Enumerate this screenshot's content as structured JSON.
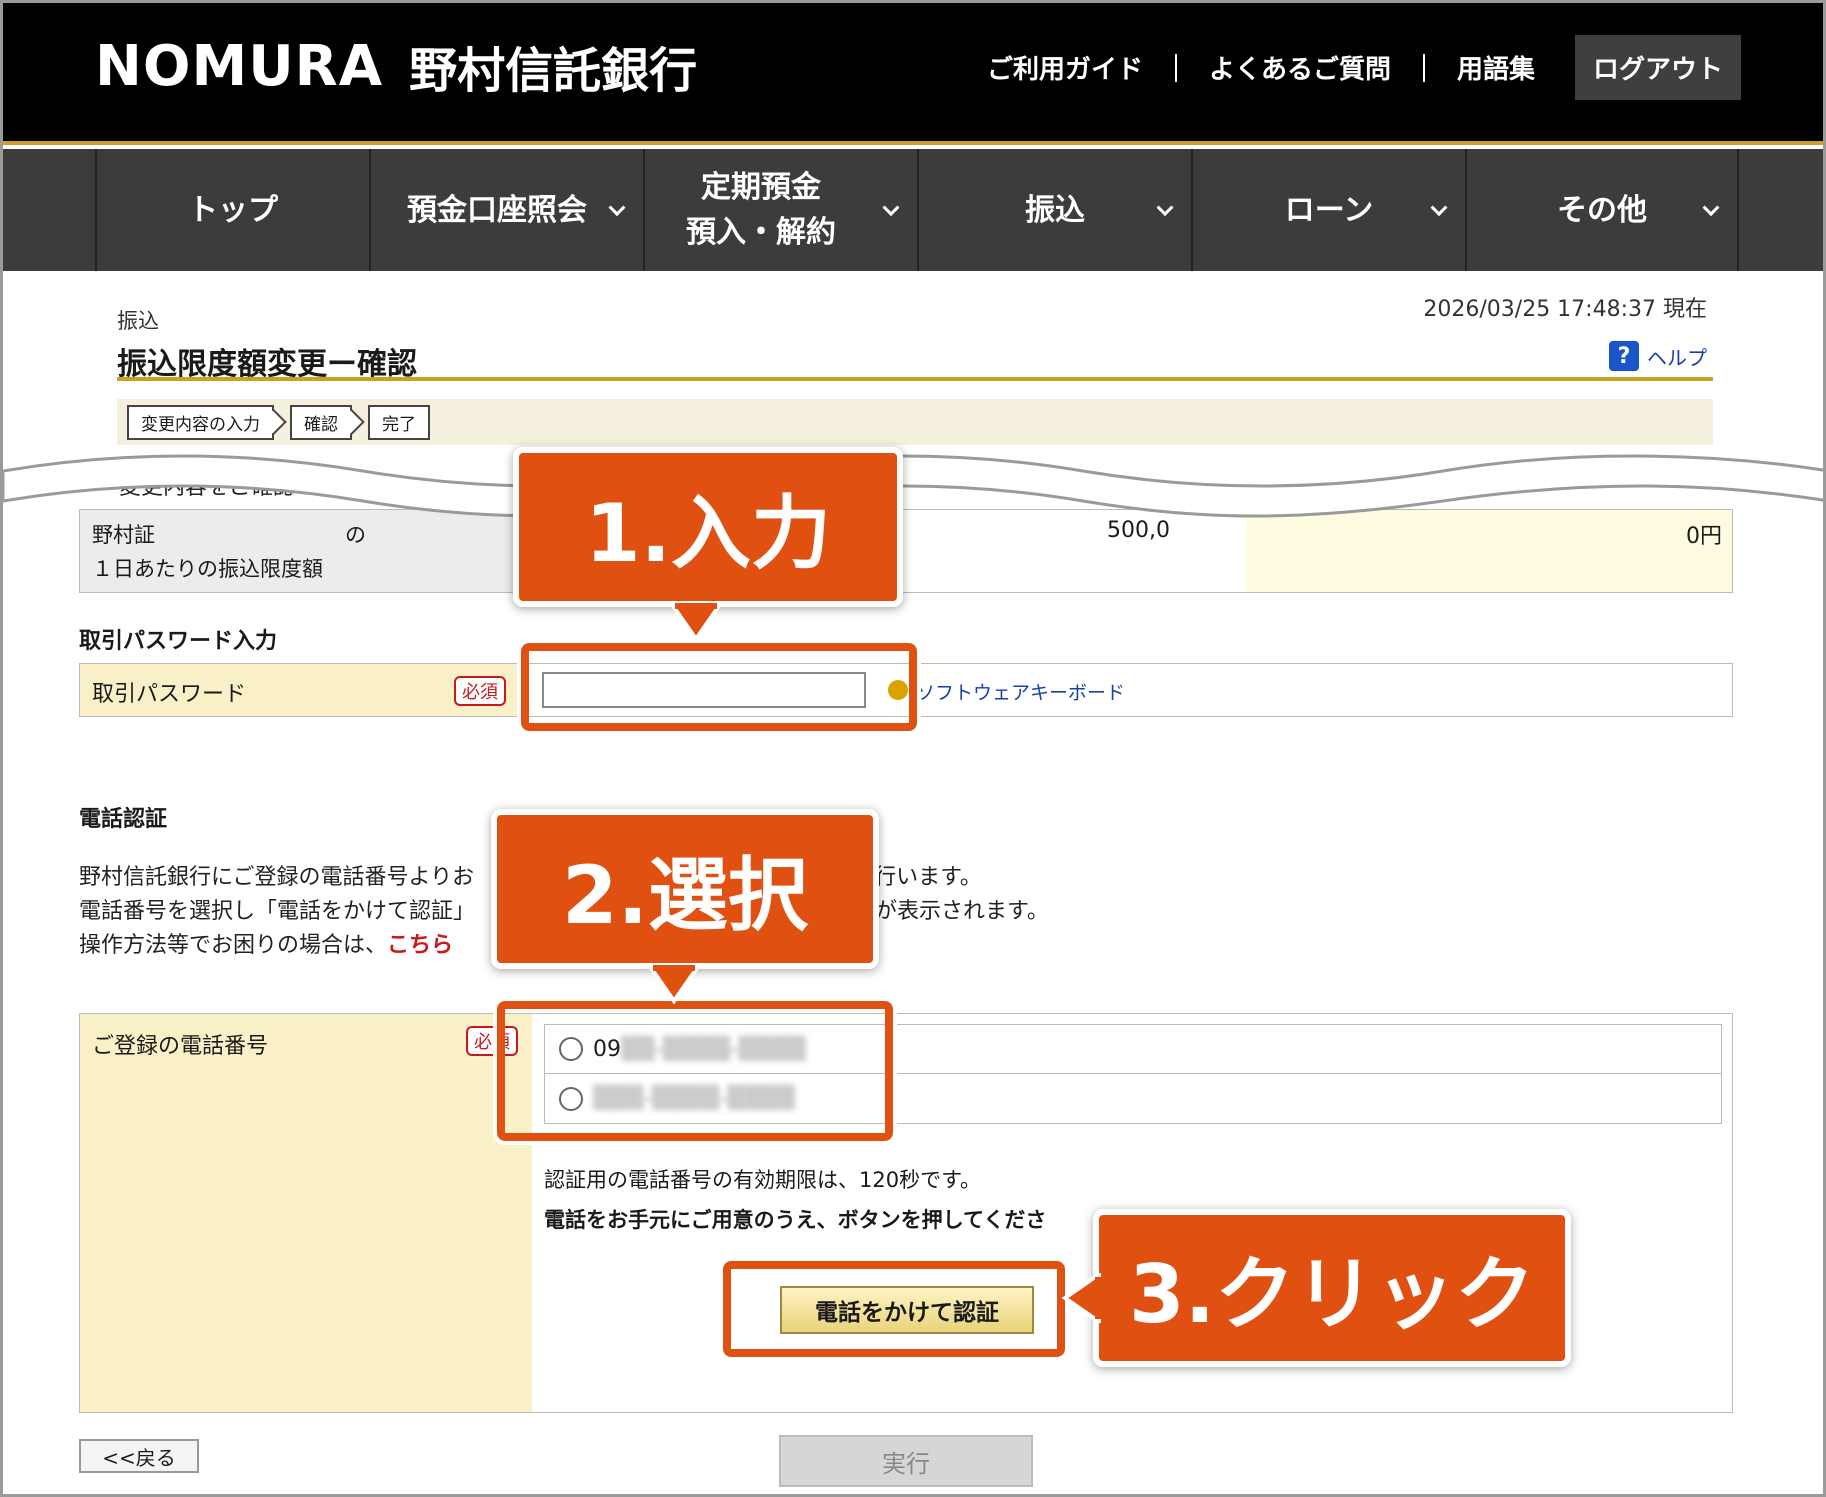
{
  "header": {
    "logo_en": "NOMURA",
    "logo_jp": "野村信託銀行",
    "links": [
      "ご利用ガイド",
      "よくあるご質問",
      "用語集"
    ],
    "logout": "ログアウト"
  },
  "nav": {
    "items": [
      {
        "label": "トップ"
      },
      {
        "label": "預金口座照会"
      },
      {
        "label": "定期預金\n預入・解約"
      },
      {
        "label": "振込"
      },
      {
        "label": "ローン"
      },
      {
        "label": "その他"
      }
    ]
  },
  "page": {
    "breadcrumb": "振込",
    "timestamp": "2026/03/25  17:48:37 現在",
    "title": "振込限度額変更ー確認",
    "help": "ヘルプ",
    "steps": [
      "変更内容の入力",
      "確認",
      "完了"
    ],
    "intro": "変更内容をご確認の上、必",
    "limit_label_line1": "野村証",
    "limit_label_suffix": "の",
    "limit_label_line2": "１日あたりの振込限度額",
    "limit_value_current": "500,0",
    "limit_value_new": "0円"
  },
  "password": {
    "section_title": "取引パスワード入力",
    "label": "取引パスワード",
    "required": "必須",
    "value": "",
    "keyboard_link": "ソフトウェアキーボード"
  },
  "tel": {
    "section_title": "電話認証",
    "line1": "野村信託銀行にご登録の電話番号よりお",
    "line1_tail": "行います。",
    "line2": "電話番号を選択し「電話をかけて認証」",
    "line2_tail": "が表示されます。",
    "line3": "操作方法等でお困りの場合は、",
    "line3_link": "こちら",
    "phone_label": "ご登録の電話番号",
    "required": "必須",
    "options": [
      "09",
      ""
    ],
    "note1": "認証用の電話番号の有効期限は、120秒です。",
    "note2": "電話をお手元にご用意のうえ、ボタンを押してくださ",
    "call_button": "電話をかけて認証"
  },
  "footer": {
    "back": "<<戻る",
    "execute": "実行"
  },
  "annotations": {
    "step1": "1.入力",
    "step2": "2.選択",
    "step3": "3.クリック"
  },
  "colors": {
    "header_bg": "#000000",
    "accent_gold": "#c9a227",
    "nav_bg": "#3c3c3c",
    "annotation": "#e05010",
    "required_red": "#c8191e",
    "label_bg": "#faf0c8"
  }
}
